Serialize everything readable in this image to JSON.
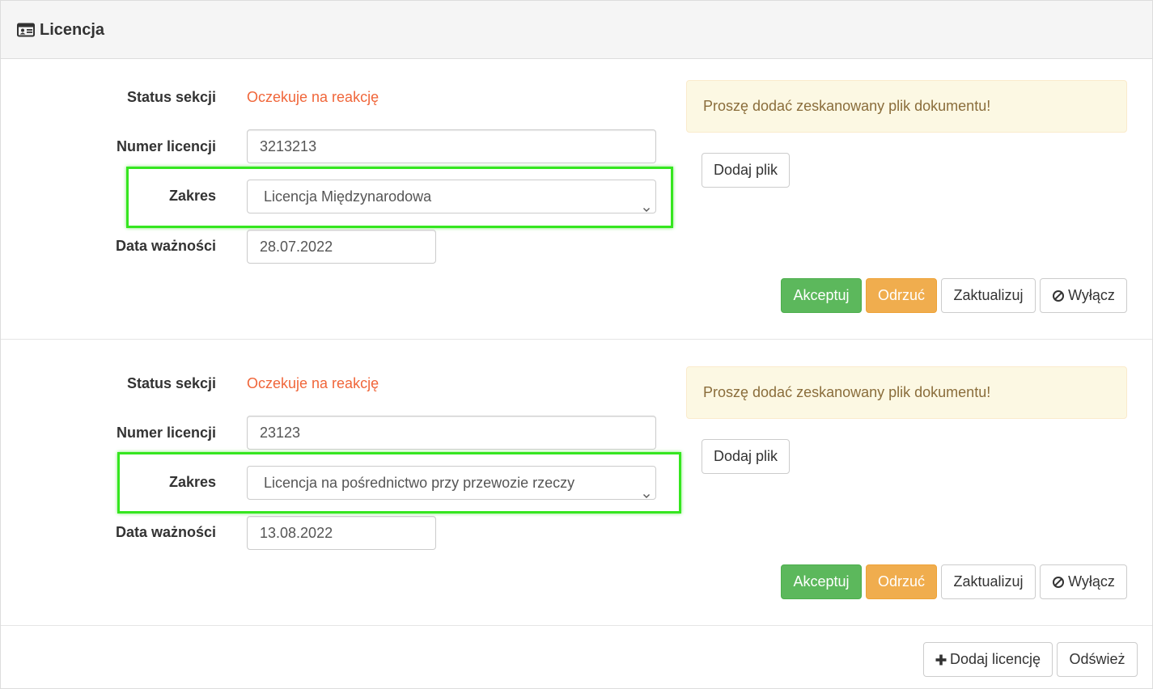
{
  "header": {
    "title": "Licencja",
    "icon": "id-card-icon"
  },
  "sections": [
    {
      "status_label": "Status sekcji",
      "status_value": "Oczekuje na reakcję",
      "number_label": "Numer licencji",
      "number_value": "3213213",
      "scope_label": "Zakres",
      "scope_value": "Licencja Międzynarodowa",
      "date_label": "Data ważności",
      "date_value": "28.07.2022",
      "alert_text": "Proszę dodać zeskanowany plik dokumentu!",
      "add_file_label": "Dodaj plik",
      "accept_label": "Akceptuj",
      "reject_label": "Odrzuć",
      "update_label": "Zaktualizuj",
      "disable_label": "Wyłącz"
    },
    {
      "status_label": "Status sekcji",
      "status_value": "Oczekuje na reakcję",
      "number_label": "Numer licencji",
      "number_value": "23123",
      "scope_label": "Zakres",
      "scope_value": "Licencja na pośrednictwo przy przewozie rzeczy",
      "date_label": "Data ważności",
      "date_value": "13.08.2022",
      "alert_text": "Proszę dodać zeskanowany plik dokumentu!",
      "add_file_label": "Dodaj plik",
      "accept_label": "Akceptuj",
      "reject_label": "Odrzuć",
      "update_label": "Zaktualizuj",
      "disable_label": "Wyłącz"
    }
  ],
  "footer": {
    "add_license_label": "Dodaj licencję",
    "refresh_label": "Odśwież"
  },
  "colors": {
    "status": "#f0663a",
    "success": "#5cb85c",
    "warning": "#f0ad4e",
    "highlight": "#35e61f",
    "alert_bg": "#fcf8e3",
    "alert_text": "#8a6d3b"
  }
}
